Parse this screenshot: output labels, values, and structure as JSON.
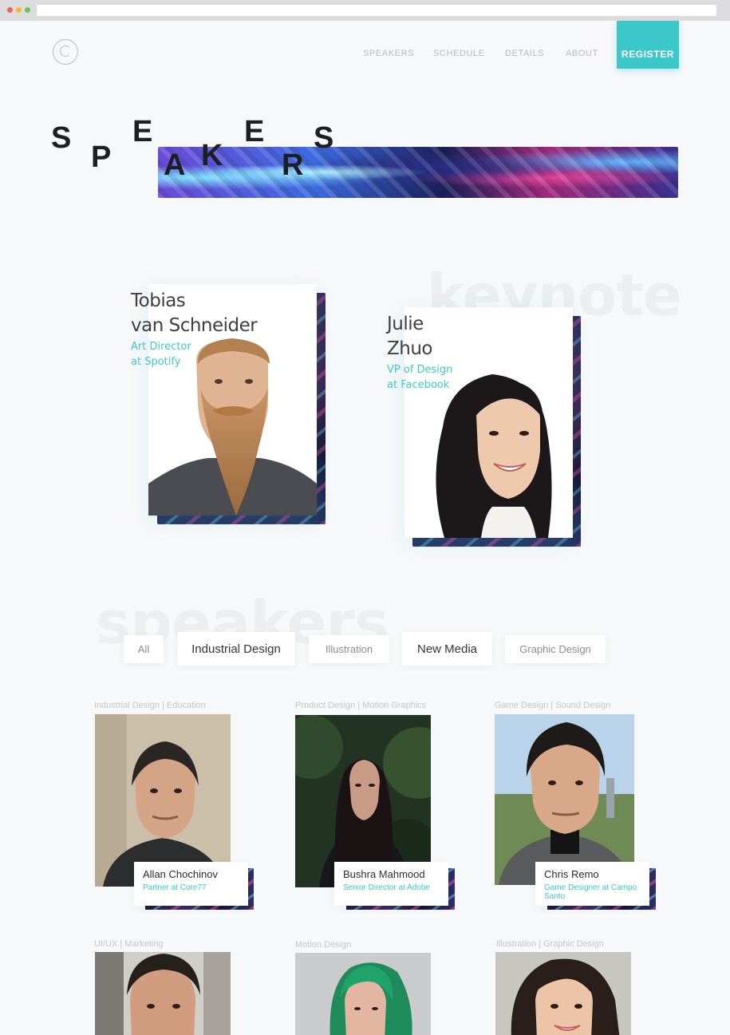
{
  "nav": {
    "links": [
      "SPEAKERS",
      "SCHEDULE",
      "DETAILS",
      "ABOUT"
    ],
    "register_label": "REGISTER"
  },
  "hero": {
    "letters": [
      "S",
      "P",
      "E",
      "A",
      "K",
      "E",
      "R",
      "S"
    ]
  },
  "keynote": {
    "ghost_word": "keynote",
    "speakers": [
      {
        "name_line1": "Tobias",
        "name_line2": "van Schneider",
        "role_line1": "Art Director",
        "role_line2": "at Spotify"
      },
      {
        "name_line1": "Julie",
        "name_line2": "Zhuo",
        "role_line1": "VP of Design",
        "role_line2": "at Facebook"
      }
    ]
  },
  "speakers_section": {
    "ghost_word": "speakers",
    "filters": [
      "All",
      "Industrial Design",
      "Illustration",
      "New Media",
      "Graphic Design"
    ]
  },
  "grid": [
    {
      "tags": "Industrial Design | Education",
      "name": "Allan Chochinov",
      "role": "Partner at Core77"
    },
    {
      "tags": "Product Design | Motion Graphics",
      "name": "Bushra Mahmood",
      "role": "Senior Director at Adobe"
    },
    {
      "tags": "Game Design | Sound Design",
      "name": "Chris Remo",
      "role": "Game Designer at Campo Santo"
    },
    {
      "tags": "UI/UX | Marketing"
    },
    {
      "tags": "Motion Design"
    },
    {
      "tags": "Illustration | Graphic Design"
    }
  ],
  "colors": {
    "accent": "#3cc8ca",
    "text_dark": "#3e4043",
    "background": "#f7f8f9"
  },
  "icons": [
    "logo-icon"
  ]
}
